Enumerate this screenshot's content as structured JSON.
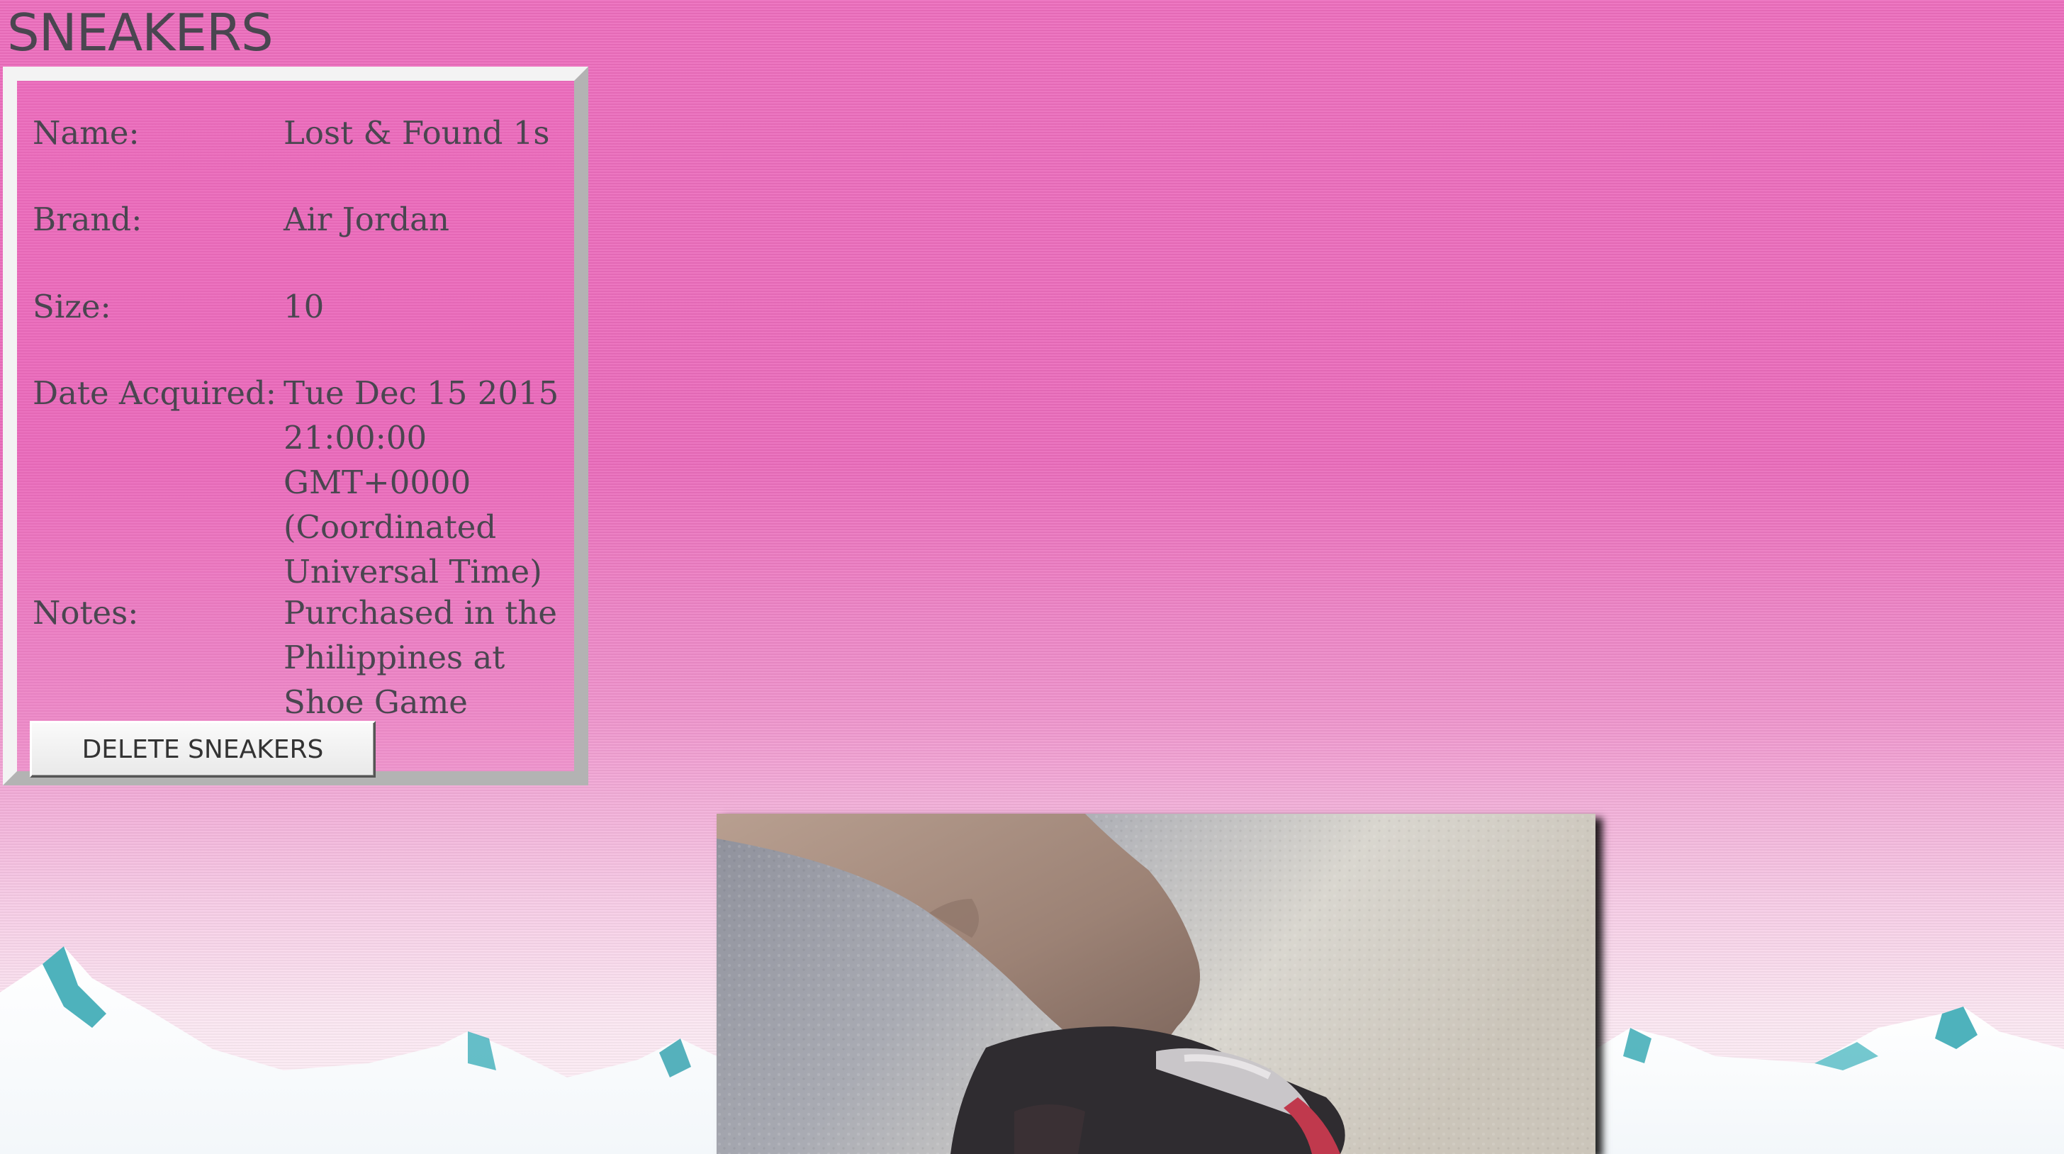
{
  "page": {
    "title": "SNEAKERS"
  },
  "details": {
    "rows": [
      {
        "label": "Name:",
        "value": "Lost & Found 1s"
      },
      {
        "label": "Brand:",
        "value": "Air Jordan"
      },
      {
        "label": "Size:",
        "value": "10"
      },
      {
        "label": "Date Acquired:",
        "value": "Tue Dec 15 2015 21:00:00 GMT+0000 (Coordinated Universal Time)"
      },
      {
        "label": "Notes:",
        "value": "Purchased in the Philippines at Shoe Game"
      }
    ],
    "delete_label": "DELETE SNEAKERS"
  },
  "colors": {
    "background_pink": "#ea6cbb",
    "text": "#4a4650",
    "panel_border_light": "#f3f3f3",
    "panel_border_dark": "#b3b3b3"
  }
}
